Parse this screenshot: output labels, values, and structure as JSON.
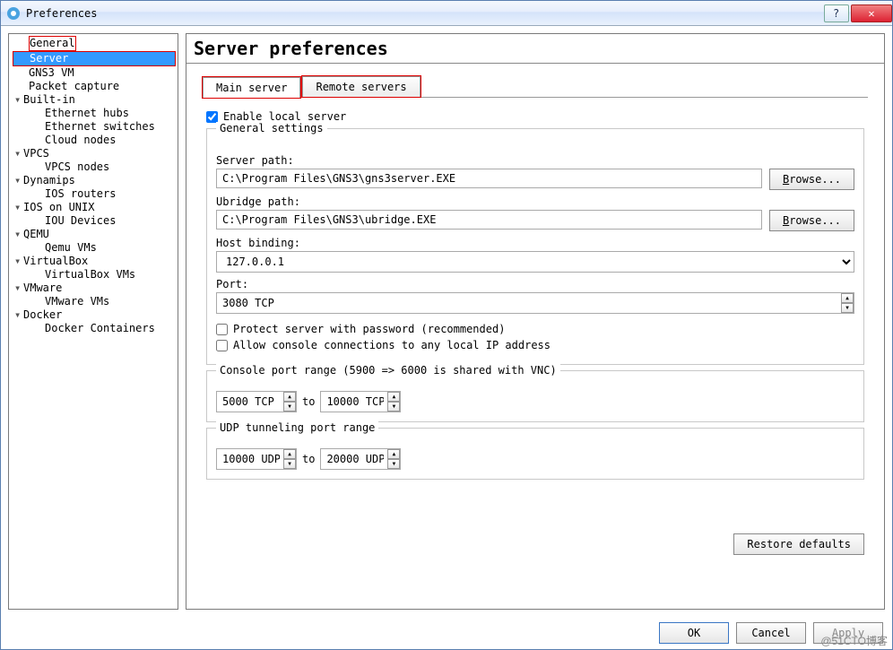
{
  "window": {
    "title": "Preferences"
  },
  "tree": {
    "general": "General",
    "server": "Server",
    "gns3vm": "GNS3 VM",
    "packetcapture": "Packet capture",
    "builtin": "Built-in",
    "ethhubs": "Ethernet hubs",
    "ethswitches": "Ethernet switches",
    "cloudnodes": "Cloud nodes",
    "vpcs": "VPCS",
    "vpcsnodes": "VPCS nodes",
    "dynamips": "Dynamips",
    "iosrouters": "IOS routers",
    "iosunix": "IOS on UNIX",
    "ioudevices": "IOU Devices",
    "qemu": "QEMU",
    "qemuvms": "Qemu VMs",
    "virtualbox": "VirtualBox",
    "virtualboxvms": "VirtualBox VMs",
    "vmware": "VMware",
    "vmwarevms": "VMware VMs",
    "docker": "Docker",
    "dockercontainers": "Docker Containers"
  },
  "heading": "Server preferences",
  "tabs": {
    "main": "Main server",
    "remote": "Remote servers"
  },
  "enable_local_server": "Enable local server",
  "general_settings_label": "General settings",
  "server_path_label": "Server path:",
  "server_path_value": "C:\\Program Files\\GNS3\\gns3server.EXE",
  "ubridge_path_label": "Ubridge path:",
  "ubridge_path_value": "C:\\Program Files\\GNS3\\ubridge.EXE",
  "browse_label": "Browse...",
  "host_binding_label": "Host binding:",
  "host_binding_value": "127.0.0.1",
  "port_label": "Port:",
  "port_value": "3080 TCP",
  "protect_label": "Protect server with password (recommended)",
  "allow_console_label": "Allow console connections to any local IP address",
  "console_range_label": "Console port range (5900 => 6000 is shared with VNC)",
  "console_from": "5000 TCP",
  "console_to": "10000 TCP",
  "udp_range_label": "UDP tunneling port range",
  "udp_from": "10000 UDP",
  "udp_to": "20000 UDP",
  "range_to": "to",
  "restore_defaults": "Restore defaults",
  "ok": "OK",
  "cancel": "Cancel",
  "apply": "Apply",
  "watermark": "@51CTO博客"
}
